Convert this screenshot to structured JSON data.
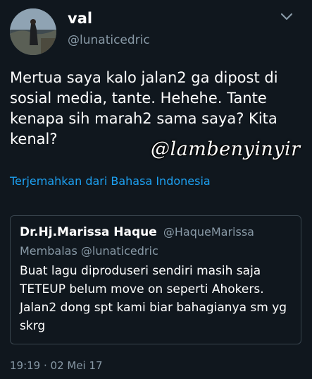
{
  "tweet": {
    "display_name": "val",
    "username": "@lunaticedric",
    "text": "Mertua saya kalo jalan2 ga dipost di\nsosial media, tante. Hehehe. Tante\nkenapa sih marah2 sama saya? Kita\nkenal?",
    "watermark": "@lambenyinyir",
    "translate_label": "Terjemahkan dari Bahasa Indonesia",
    "timestamp": "19:19 · 02 Mei 17"
  },
  "quoted_tweet": {
    "display_name": "Dr.Hj.Marissa Haque",
    "username": "@HaqueMarissa",
    "reply_to": "Membalas @lunaticedric",
    "text": "Buat lagu diproduseri sendiri masih saja\nTETEUP belum move on seperti Ahokers.\nJalan2 dong spt kami biar bahagianya sm yg\nskrg"
  },
  "icons": {
    "menu": "chevron-down-icon",
    "avatar": "avatar"
  },
  "colors": {
    "background": "#10171e",
    "link": "#1da1f2",
    "secondary_text": "#8899a6",
    "border": "#38444d"
  }
}
